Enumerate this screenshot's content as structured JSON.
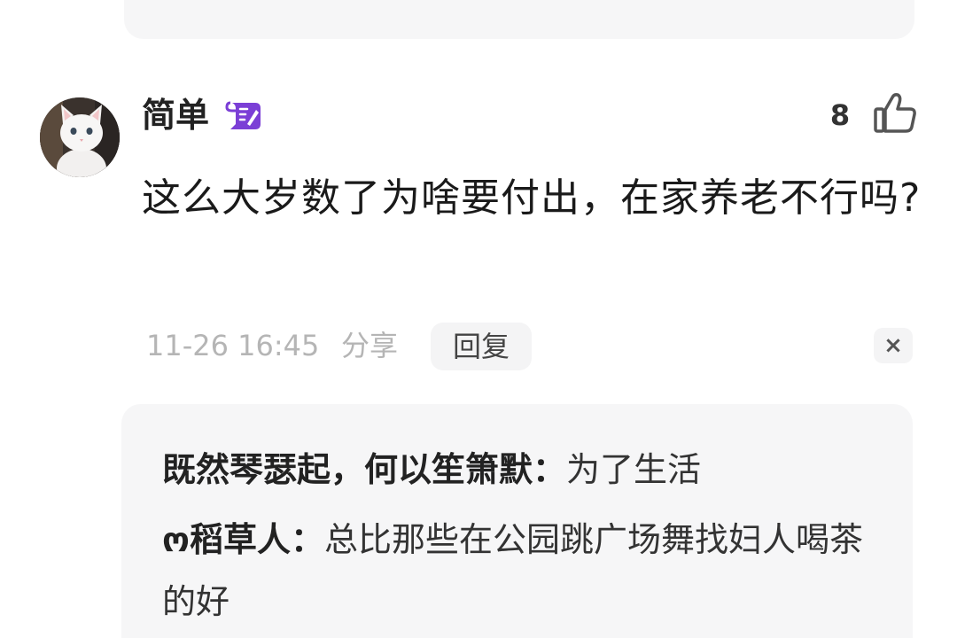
{
  "comment": {
    "username": "简单",
    "badge_icon": "creator-badge-icon",
    "like_count": "8",
    "like_icon": "thumbs-up-icon",
    "text": "这么大岁数了为啥要付出，在家养老不行吗?",
    "time": "11-26 16:45",
    "share_label": "分享",
    "reply_label": "回复",
    "close_label": "×"
  },
  "replies": [
    {
      "author": "既然琴瑟起，何以笙箫默：",
      "text": "为了生活"
    },
    {
      "author": "ო稻草人：",
      "text": "总比那些在公园跳广场舞找妇人喝茶的好"
    }
  ],
  "colors": {
    "badge_purple": "#7b3fd6",
    "card_background": "#f6f6f7",
    "meta_gray": "#b5b5b5"
  }
}
